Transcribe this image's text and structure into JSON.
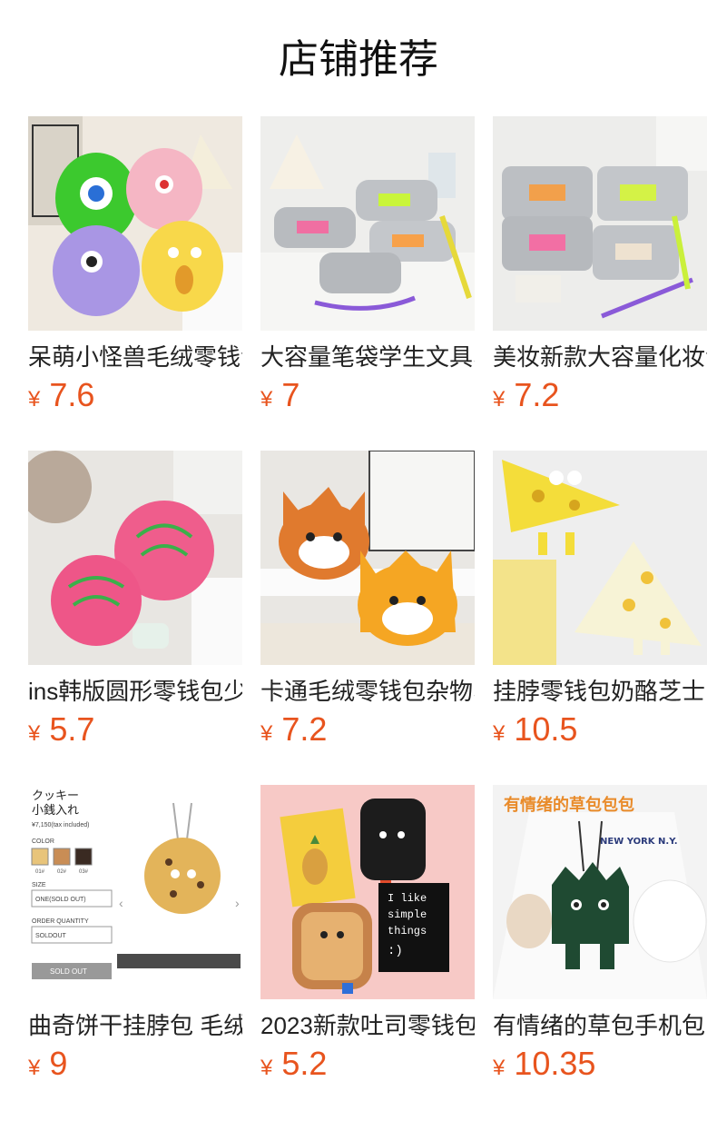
{
  "header": {
    "title": "店铺推荐"
  },
  "currency": "¥",
  "products": [
    {
      "name": "呆萌小怪兽毛绒零钱包",
      "price": "7.6",
      "image": "plush-monsters"
    },
    {
      "name": "大容量笔袋学生文具收纳",
      "price": "7",
      "image": "silver-pencil-case"
    },
    {
      "name": "美妆新款大容量化妆包",
      "price": "7.2",
      "image": "silver-makeup-bag"
    },
    {
      "name": "ins韩版圆形零钱包少女",
      "price": "5.7",
      "image": "pink-round-coin-purse"
    },
    {
      "name": "卡通毛绒零钱包杂物收纳",
      "price": "7.2",
      "image": "fox-plush-purse"
    },
    {
      "name": "挂脖零钱包奶酪芝士",
      "price": "10.5",
      "image": "cheese-purse"
    },
    {
      "name": "曲奇饼干挂脖包 毛绒",
      "price": "9",
      "image": "cookie-neck-bag",
      "image_text": {
        "title_line1": "クッキー",
        "title_line2": "小銭入れ",
        "tax": "¥7,150(tax included)",
        "color_label": "COLOR",
        "swatches": [
          "01#",
          "02#",
          "03#"
        ],
        "size_label": "SIZE",
        "size_value": "ONE(SOLD OUT)",
        "qty_label": "ORDER QUANTITY",
        "qty_value": "SOLDOUT",
        "button": "SOLD OUT"
      }
    },
    {
      "name": "2023新款吐司零钱包",
      "price": "5.2",
      "image": "toast-coin-purse",
      "image_text": {
        "card": "I like simple things :)"
      }
    },
    {
      "name": "有情绪的草包手机包",
      "price": "10.35",
      "image": "green-grass-phone-bag",
      "image_text": {
        "banner": "有情绪的草包包包",
        "shirt": "NEW YORK N.Y."
      }
    }
  ]
}
